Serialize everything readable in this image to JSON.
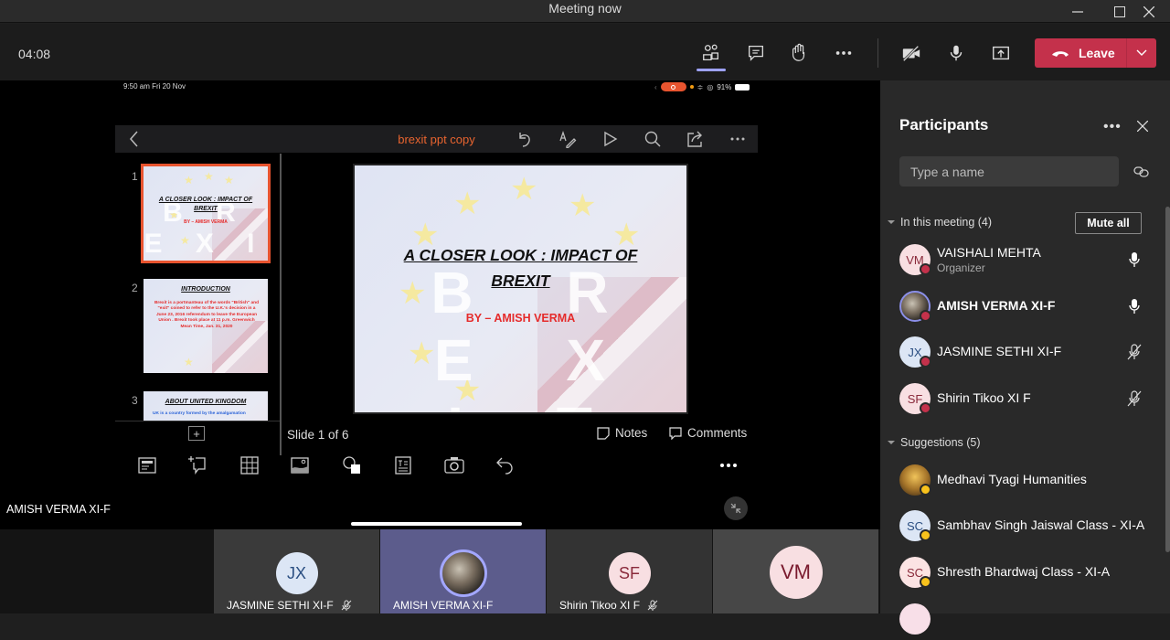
{
  "window": {
    "title": "Meeting now",
    "controls": [
      "minimize-icon",
      "maximize-icon",
      "close-icon"
    ]
  },
  "toolbar": {
    "timer": "04:08",
    "buttons": [
      "participants-icon",
      "chat-icon",
      "raise-hand-icon",
      "more-icon",
      "camera-off-icon",
      "microphone-icon",
      "share-screen-icon"
    ],
    "leave_label": "Leave",
    "colors": {
      "leave": "#c4314b",
      "active_underline": "#9ea2ff"
    }
  },
  "shared_screen": {
    "status_time": "9:50 am  Fri 20 Nov",
    "battery": "91%",
    "app_title": "brexit ppt copy",
    "toolbar_icons": [
      "back-icon",
      "undo-icon",
      "draw-icon",
      "play-icon",
      "search-icon",
      "share-icon",
      "more-icon"
    ],
    "thumbnails": [
      {
        "number": "1",
        "title": "A CLOSER LOOK : IMPACT OF BREXIT",
        "subtitle": "BY – AMISH VERMA",
        "selected": true
      },
      {
        "number": "2",
        "title": "INTRODUCTION",
        "body": "Brexit is a portmanteau of the words \"British\" and \"exit\" coined to refer to the U.K.'s decision in a June 23, 2016 referendum to leave the European Union . Brexit took place at 11 p.m. Greenwich Mean Time, Jan. 31, 2020"
      },
      {
        "number": "3",
        "title": "ABOUT UNITED KINGDOM",
        "body": "UK is a country formed by the amalgamation"
      }
    ],
    "slide": {
      "title_line1": "A CLOSER LOOK : IMPACT OF",
      "title_line2": "BREXIT",
      "watermark": "B R E X I T",
      "subtitle": "BY – AMISH VERMA"
    },
    "slide_counter": "Slide 1 of 6",
    "notes_label": "Notes",
    "comments_label": "Comments",
    "bottom_tools": [
      "layout-icon",
      "new-comment-icon",
      "table-icon",
      "picture-icon",
      "shapes-icon",
      "textbox-icon",
      "camera-icon",
      "undo-icon",
      "more-icon"
    ],
    "presenter_name": "AMISH VERMA XI-F"
  },
  "gallery": [
    {
      "initials": "JX",
      "name": "JASMINE SETHI XI-F",
      "muted": true
    },
    {
      "initials": "",
      "name": "AMISH VERMA XI-F",
      "muted": false,
      "photo": true,
      "speaking": true
    },
    {
      "initials": "SF",
      "name": "Shirin Tikoo XI F",
      "muted": true
    },
    {
      "initials": "VM",
      "name": "",
      "muted": false
    }
  ],
  "participants_panel": {
    "title": "Participants",
    "search_placeholder": "Type a name",
    "in_meeting_label": "In this meeting (4)",
    "mute_all_label": "Mute all",
    "in_meeting": [
      {
        "initials": "VM",
        "name": "VAISHALI MEHTA",
        "role": "Organizer",
        "mic": "on",
        "status": "busy"
      },
      {
        "initials": "",
        "name": "AMISH VERMA XI-F",
        "role": "",
        "mic": "on",
        "status": "dnd",
        "photo": true
      },
      {
        "initials": "JX",
        "name": "JASMINE SETHI XI-F",
        "role": "",
        "mic": "muted",
        "status": "busy"
      },
      {
        "initials": "SF",
        "name": "Shirin Tikoo XI F",
        "role": "",
        "mic": "muted",
        "status": "busy"
      }
    ],
    "suggestions_label": "Suggestions (5)",
    "suggestions": [
      {
        "initials": "",
        "name": "Medhavi Tyagi Humanities",
        "status": "away",
        "photo": true
      },
      {
        "initials": "SC",
        "name": "Sambhav Singh Jaiswal Class - XI-A",
        "status": "away"
      },
      {
        "initials": "SC",
        "name": "Shresth Bhardwaj Class - XI-A",
        "status": "away"
      }
    ]
  }
}
